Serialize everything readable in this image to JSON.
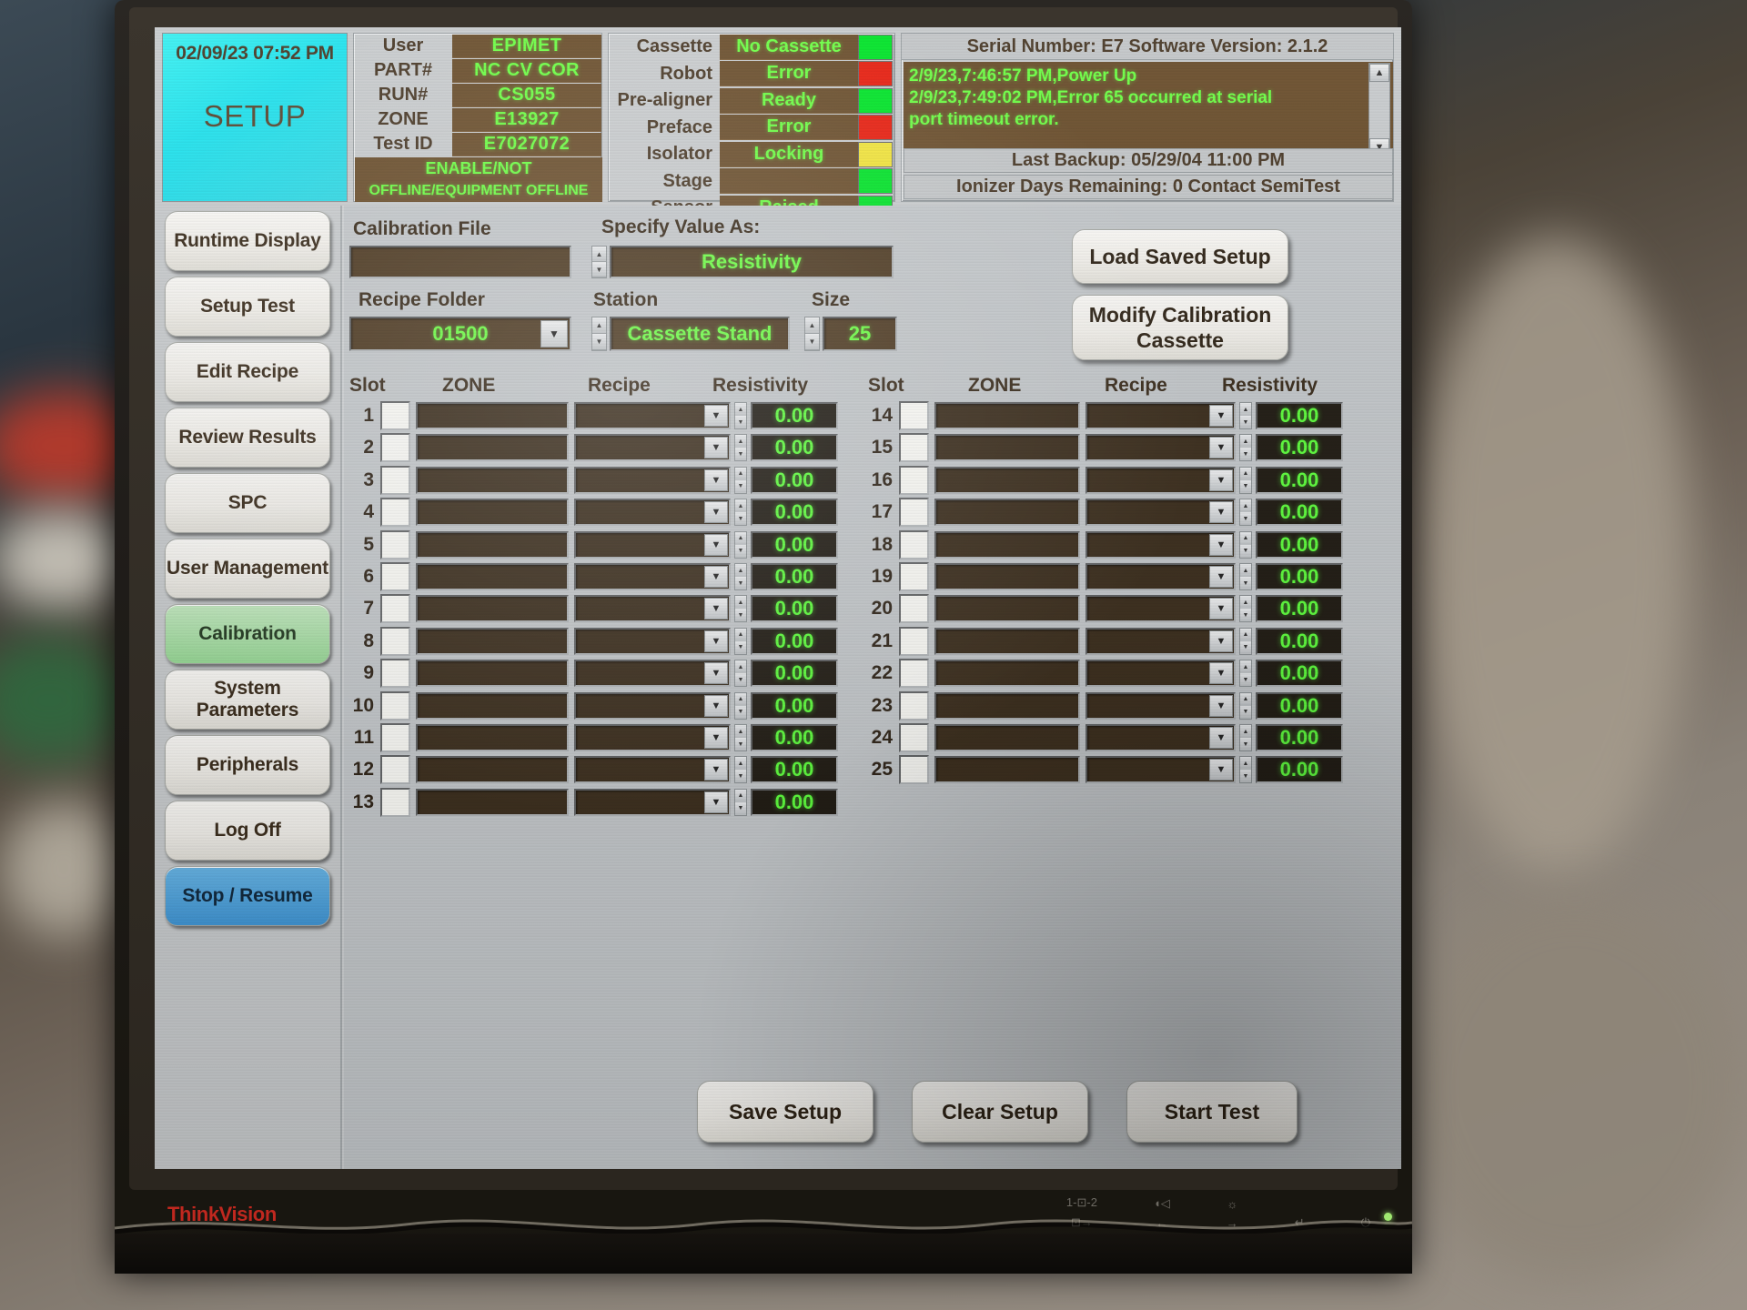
{
  "header": {
    "datetime": "02/09/23 07:52 PM",
    "mode_title": "SETUP",
    "info_rows": [
      {
        "label": "User",
        "value": "EPIMET"
      },
      {
        "label": "PART#",
        "value": "NC CV COR"
      },
      {
        "label": "RUN#",
        "value": "CS055"
      },
      {
        "label": "ZONE",
        "value": "E13927"
      },
      {
        "label": "Test ID",
        "value": "E7027072"
      }
    ],
    "enable_line": "ENABLE/NOT",
    "offline_line": "OFFLINE/EQUIPMENT OFFLINE",
    "status_rows": [
      {
        "label": "Cassette",
        "value": "No Cassette",
        "led": "#00e528"
      },
      {
        "label": "Robot",
        "value": "Error",
        "led": "#e81f10"
      },
      {
        "label": "Pre-aligner",
        "value": "Ready",
        "led": "#00e528"
      },
      {
        "label": "Preface",
        "value": "Error",
        "led": "#e81f10"
      },
      {
        "label": "Isolator",
        "value": "Locking",
        "led": "#f2e53c"
      },
      {
        "label": "Stage",
        "value": "",
        "led": "#00e528"
      },
      {
        "label": "Sensor",
        "value": "Raised",
        "led": "#00e528"
      }
    ],
    "serial_line": "Serial Number: E7  Software Version: 2.1.2",
    "log_lines": [
      "2/9/23,7:46:57 PM,Power Up",
      "2/9/23,7:49:02 PM,Error 65 occurred at serial",
      "port timeout error."
    ],
    "last_backup": "Last Backup: 05/29/04 11:00 PM",
    "ionizer": "Ionizer Days Remaining: 0 Contact SemiTest",
    "scroll_up_icon": "▲",
    "scroll_down_icon": "▼"
  },
  "sidebar": {
    "items": [
      {
        "label": "Runtime Display",
        "state": "normal"
      },
      {
        "label": "Setup Test",
        "state": "normal"
      },
      {
        "label": "Edit Recipe",
        "state": "normal"
      },
      {
        "label": "Review Results",
        "state": "normal"
      },
      {
        "label": "SPC",
        "state": "normal"
      },
      {
        "label": "User Management",
        "state": "normal"
      },
      {
        "label": "Calibration",
        "state": "active-green"
      },
      {
        "label": "System Parameters",
        "state": "normal"
      },
      {
        "label": "Peripherals",
        "state": "normal"
      },
      {
        "label": "Log Off",
        "state": "normal"
      },
      {
        "label": "Stop / Resume",
        "state": "active-blue"
      }
    ]
  },
  "form": {
    "calibration_file_label": "Calibration File",
    "calibration_file_value": "",
    "recipe_folder_label": "Recipe Folder",
    "recipe_folder_value": "01500",
    "specify_value_label": "Specify Value As:",
    "specify_value_value": "Resistivity",
    "station_label": "Station",
    "station_value": "Cassette Stand",
    "size_label": "Size",
    "size_value": "25",
    "dropdown_icon": "▼",
    "spin_up_icon": "▲",
    "spin_down_icon": "▼",
    "load_saved_setup": "Load Saved Setup",
    "modify_calibration_cassette": "Modify Calibration\nCassette"
  },
  "table": {
    "headers": {
      "slot": "Slot",
      "zone": "ZONE",
      "recipe": "Recipe",
      "resistivity": "Resistivity"
    },
    "left_rows": [
      {
        "slot": "1",
        "checked": false,
        "zone": "",
        "recipe": "",
        "resistivity": "0.00"
      },
      {
        "slot": "2",
        "checked": false,
        "zone": "",
        "recipe": "",
        "resistivity": "0.00"
      },
      {
        "slot": "3",
        "checked": false,
        "zone": "",
        "recipe": "",
        "resistivity": "0.00"
      },
      {
        "slot": "4",
        "checked": false,
        "zone": "",
        "recipe": "",
        "resistivity": "0.00"
      },
      {
        "slot": "5",
        "checked": false,
        "zone": "",
        "recipe": "",
        "resistivity": "0.00"
      },
      {
        "slot": "6",
        "checked": false,
        "zone": "",
        "recipe": "",
        "resistivity": "0.00"
      },
      {
        "slot": "7",
        "checked": false,
        "zone": "",
        "recipe": "",
        "resistivity": "0.00"
      },
      {
        "slot": "8",
        "checked": false,
        "zone": "",
        "recipe": "",
        "resistivity": "0.00"
      },
      {
        "slot": "9",
        "checked": false,
        "zone": "",
        "recipe": "",
        "resistivity": "0.00"
      },
      {
        "slot": "10",
        "checked": false,
        "zone": "",
        "recipe": "",
        "resistivity": "0.00"
      },
      {
        "slot": "11",
        "checked": false,
        "zone": "",
        "recipe": "",
        "resistivity": "0.00"
      },
      {
        "slot": "12",
        "checked": false,
        "zone": "",
        "recipe": "",
        "resistivity": "0.00"
      },
      {
        "slot": "13",
        "checked": false,
        "zone": "",
        "recipe": "",
        "resistivity": "0.00"
      }
    ],
    "right_rows": [
      {
        "slot": "14",
        "checked": false,
        "zone": "",
        "recipe": "",
        "resistivity": "0.00"
      },
      {
        "slot": "15",
        "checked": false,
        "zone": "",
        "recipe": "",
        "resistivity": "0.00"
      },
      {
        "slot": "16",
        "checked": false,
        "zone": "",
        "recipe": "",
        "resistivity": "0.00"
      },
      {
        "slot": "17",
        "checked": false,
        "zone": "",
        "recipe": "",
        "resistivity": "0.00"
      },
      {
        "slot": "18",
        "checked": false,
        "zone": "",
        "recipe": "",
        "resistivity": "0.00"
      },
      {
        "slot": "19",
        "checked": false,
        "zone": "",
        "recipe": "",
        "resistivity": "0.00"
      },
      {
        "slot": "20",
        "checked": false,
        "zone": "",
        "recipe": "",
        "resistivity": "0.00"
      },
      {
        "slot": "21",
        "checked": false,
        "zone": "",
        "recipe": "",
        "resistivity": "0.00"
      },
      {
        "slot": "22",
        "checked": false,
        "zone": "",
        "recipe": "",
        "resistivity": "0.00"
      },
      {
        "slot": "23",
        "checked": false,
        "zone": "",
        "recipe": "",
        "resistivity": "0.00"
      },
      {
        "slot": "24",
        "checked": false,
        "zone": "",
        "recipe": "",
        "resistivity": "0.00"
      },
      {
        "slot": "25",
        "checked": false,
        "zone": "",
        "recipe": "",
        "resistivity": "0.00"
      }
    ]
  },
  "actions": {
    "save_setup": "Save Setup",
    "clear_setup": "Clear Setup",
    "start_test": "Start Test"
  },
  "monitor": {
    "brand": "ThinkVision",
    "osd": [
      {
        "name": "input-select-icon",
        "top": "1-⊡-2",
        "bottom": "⊡→"
      },
      {
        "name": "image-setup-icon",
        "top": "◖◁",
        "bottom": "←"
      },
      {
        "name": "brightness-icon",
        "top": "☼",
        "bottom": "→"
      },
      {
        "name": "enter-icon",
        "top": "",
        "bottom": "↵"
      },
      {
        "name": "power-icon",
        "top": "",
        "bottom": "⏻"
      }
    ]
  },
  "colors": {
    "screen_bg": "#c4c8cb",
    "field_bg": "#4e3a22",
    "field_text": "#6dff45",
    "led_green": "#00e528",
    "led_red": "#e81f10",
    "led_yellow": "#f2e53c",
    "accent_cyan": "#2ce4ee",
    "brand_red": "#c0281f"
  }
}
